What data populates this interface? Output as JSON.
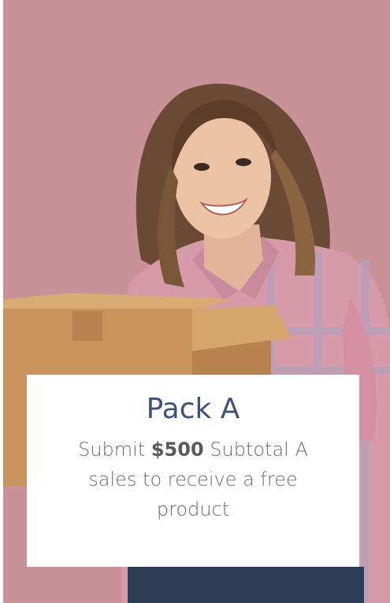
{
  "promo": {
    "title": "Pack A",
    "text_before": "Submit ",
    "amount": "$500",
    "text_after": " Subtotal A sales to receive a free product"
  },
  "photo": {
    "subject": "smiling woman holding cardboard box",
    "background_color": "#c99298"
  },
  "colors": {
    "title": "#3d5277",
    "body_text": "#6b6b6b",
    "panel": "#ffffff"
  }
}
